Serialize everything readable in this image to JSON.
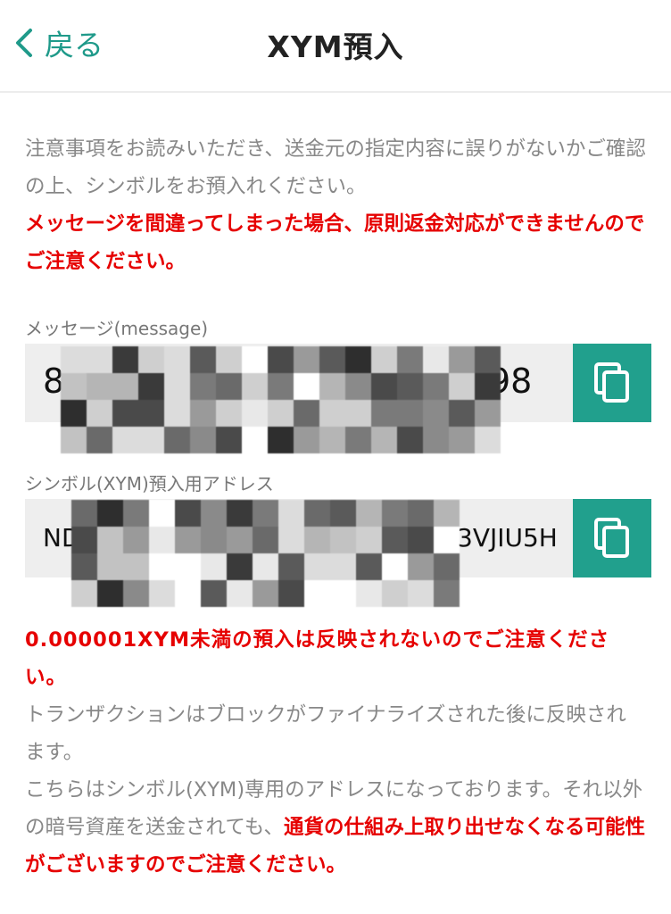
{
  "header": {
    "back_label": "戻る",
    "title": "XYM預入"
  },
  "notice": {
    "line1": "注意事項をお読みいただき、送金元の指定内容に誤りがないかご確認の上、シンボルをお預入れください。",
    "warning": "メッセージを間違ってしまった場合、原則返金対応ができませんのでご注意ください。"
  },
  "message_field": {
    "label": "メッセージ(message)",
    "value_start": "8",
    "value_end": "98"
  },
  "address_field": {
    "label": "シンボル(XYM)預入用アドレス",
    "value_start": "ND",
    "value_end": "3VJIU5H"
  },
  "notes": {
    "min_warning": "0.000001XYM未満の預入は反映されないのでご注意ください。",
    "finalize": "トランザクションはブロックがファイナライズされた後に反映されます。",
    "exclusive_prefix": "こちらはシンボル(XYM)専用のアドレスになっております。それ以外の暗号資産を送金されても、",
    "exclusive_warning": "通貨の仕組み上取り出せなくなる可能性がございますのでご注意ください。"
  },
  "colors": {
    "accent": "#21a08d",
    "warning": "#e60000"
  }
}
